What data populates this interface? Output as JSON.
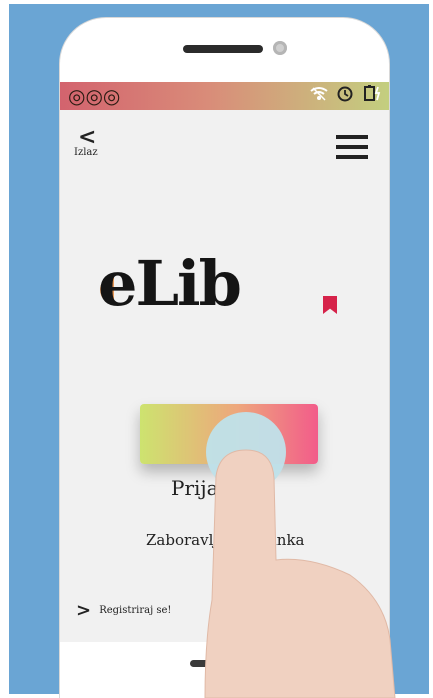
{
  "status_bar": {
    "left_icons": "◎◎◎",
    "wifi_icon": "wifi-icon",
    "alarm_icon": "alarm-icon",
    "battery_icon": "battery-charging-icon"
  },
  "header": {
    "back_arrow": "<",
    "back_label": "Izlaz"
  },
  "logo": {
    "text": "eLib"
  },
  "main": {
    "login_button_label": "Prijava se",
    "forgot_password": "Zaboravljena lozinka"
  },
  "footer": {
    "register_arrow": ">",
    "register_label": "Registriraj se!"
  },
  "colors": {
    "background": "#6aa5d4",
    "gradient_start": "#cde36f",
    "gradient_end": "#f25c8a",
    "bookmark": "#d6234a"
  }
}
